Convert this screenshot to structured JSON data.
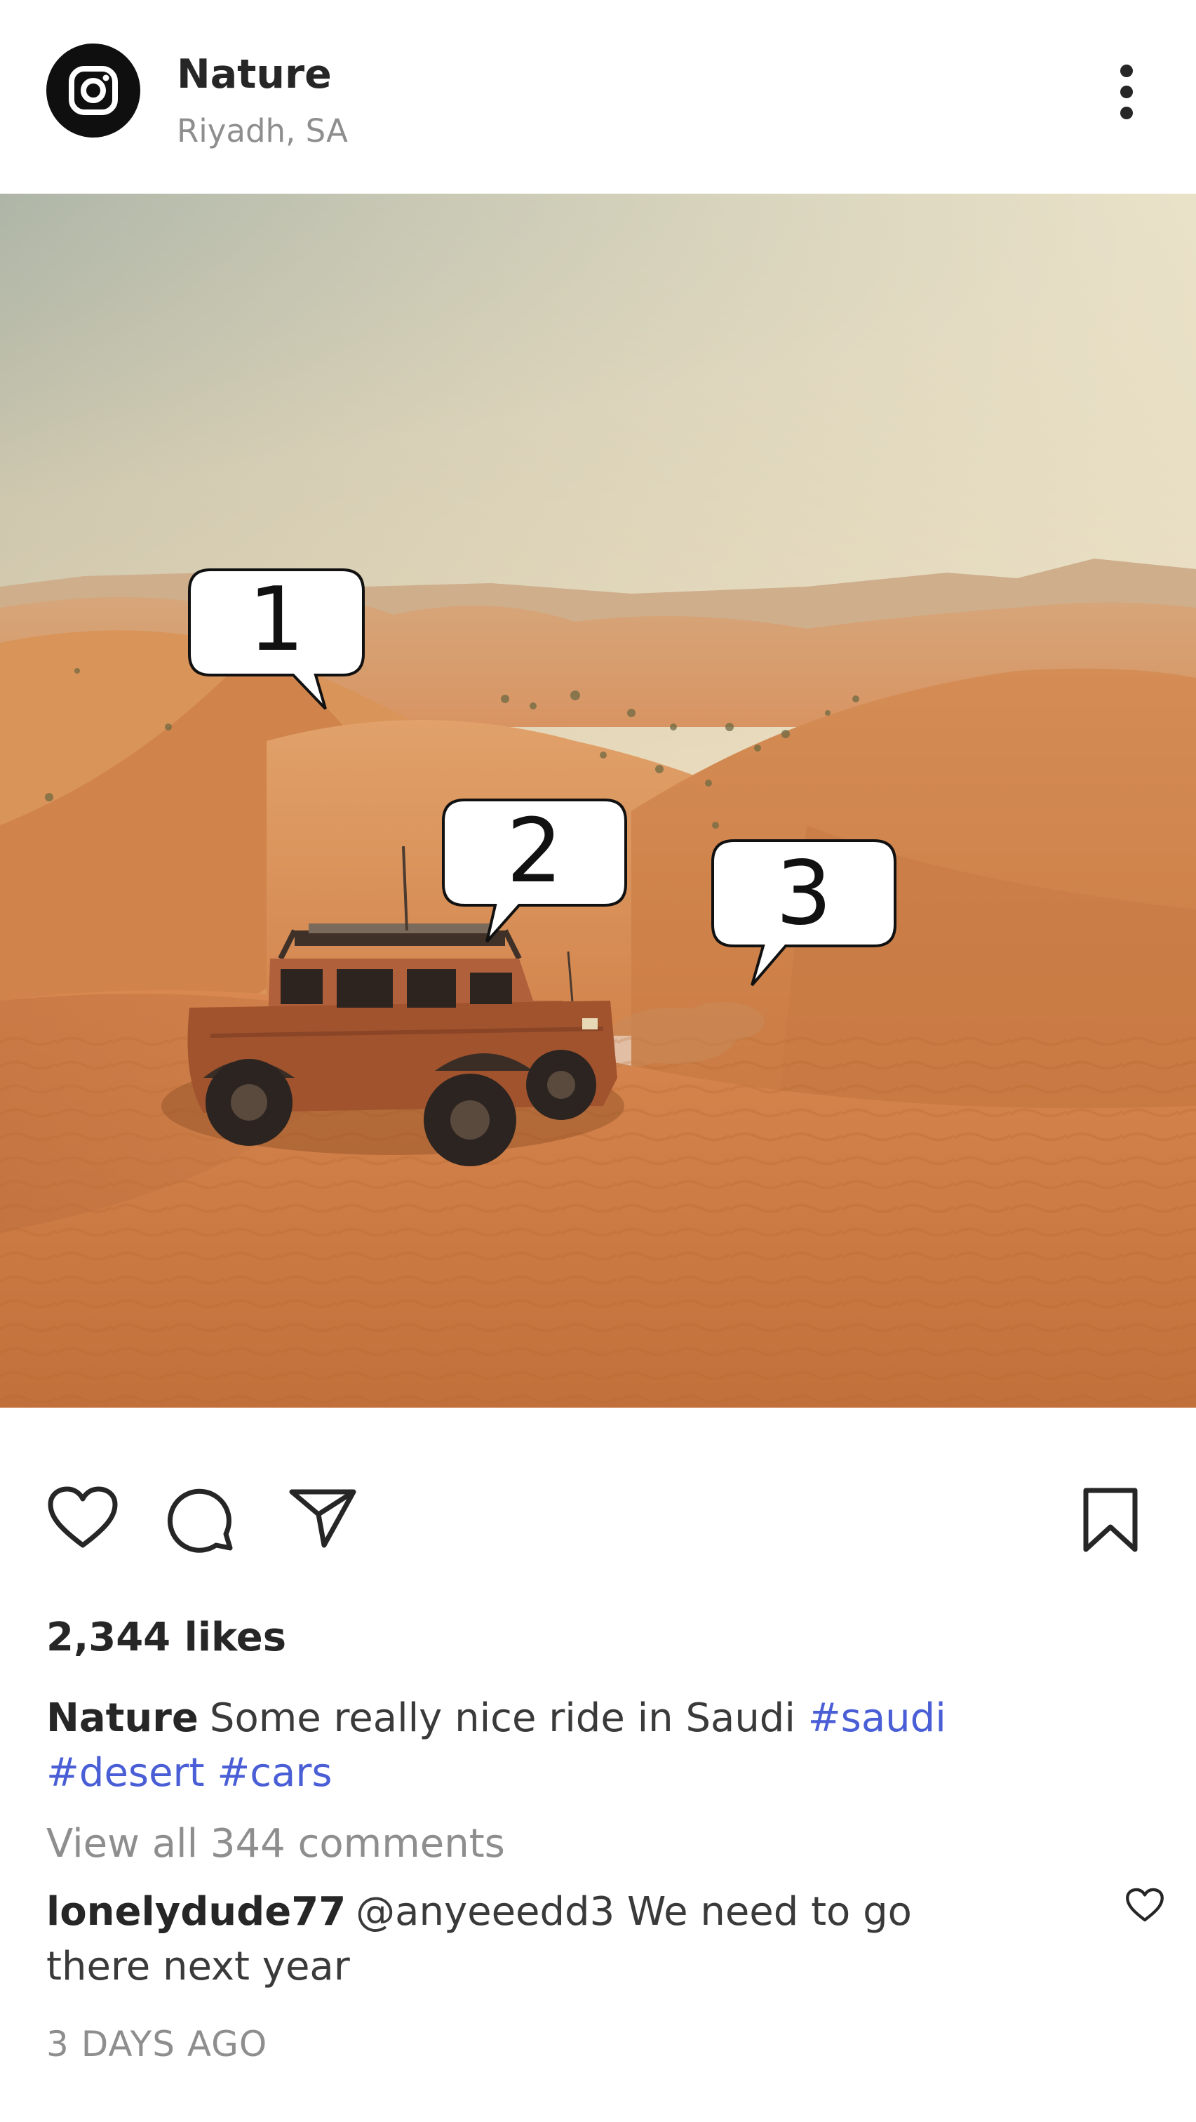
{
  "post": {
    "account_name": "Nature",
    "location": "Riyadh, SA",
    "avatar_icon": "instagram-logo-icon",
    "more_icon": "more-vertical-icon"
  },
  "image": {
    "callouts": [
      "1",
      "2",
      "3"
    ]
  },
  "actions": {
    "like_icon": "heart-icon",
    "comment_icon": "comment-icon",
    "share_icon": "send-icon",
    "save_icon": "bookmark-icon"
  },
  "likes": "2,344 likes",
  "caption": {
    "author": "Nature",
    "text": "Some really nice ride in Saudi",
    "hashtags": [
      "#saudi",
      "#desert",
      "#cars"
    ]
  },
  "view_all_comments": "View all 344 comments",
  "top_comment": {
    "author": "lonelydude77",
    "text": "@anyeeedd3 We need to go there next year"
  },
  "timestamp": "3 DAYS AGO",
  "colors": {
    "hashtag": "#4a5fd6",
    "muted": "#8e8e8e",
    "text": "#262626",
    "sand": "#d98c52"
  }
}
